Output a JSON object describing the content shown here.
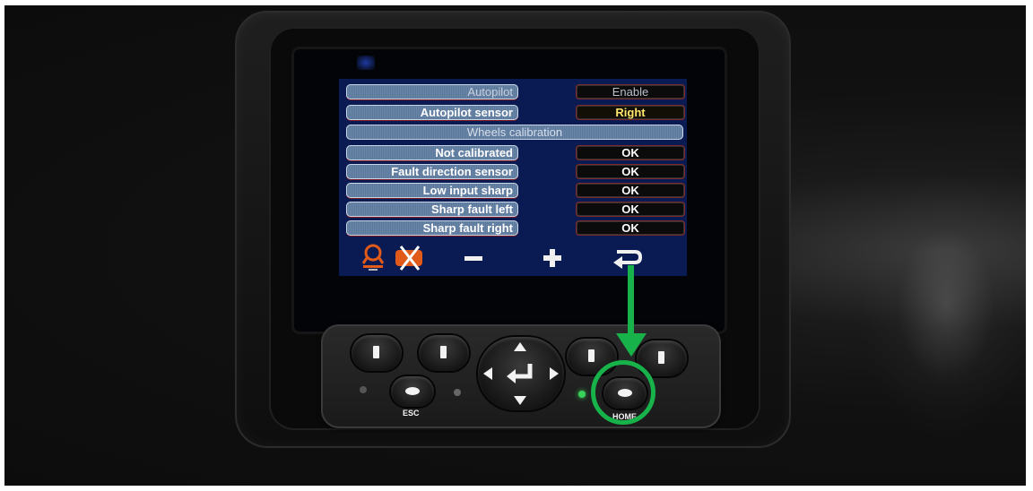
{
  "settings": {
    "rows": [
      {
        "label": "Autopilot",
        "value": "Enable"
      },
      {
        "label": "Autopilot sensor",
        "value": "Right"
      },
      {
        "header": "Wheels calibration"
      },
      {
        "label": "Not calibrated",
        "value": "OK"
      },
      {
        "label": "Fault direction sensor",
        "value": "OK"
      },
      {
        "label": "Low input sharp",
        "value": "OK"
      },
      {
        "label": "Sharp fault left",
        "value": "OK"
      },
      {
        "label": "Sharp fault right",
        "value": "OK"
      }
    ]
  },
  "softkeys": [
    {
      "icon": "steering-icon"
    },
    {
      "icon": "disable-x-icon"
    },
    {
      "icon": "minus-icon",
      "glyph": "−"
    },
    {
      "icon": "plus-icon",
      "glyph": "+"
    },
    {
      "icon": "return-arrow-icon"
    }
  ],
  "keypad": {
    "esc_label": "ESC",
    "home_label": "HOME",
    "enter_icon": "enter-icon"
  },
  "colors": {
    "screen_bg": "#0a1a52",
    "annotation": "#17b24a",
    "led_green": "#39d25a",
    "value_yellow": "#ffe56b"
  }
}
